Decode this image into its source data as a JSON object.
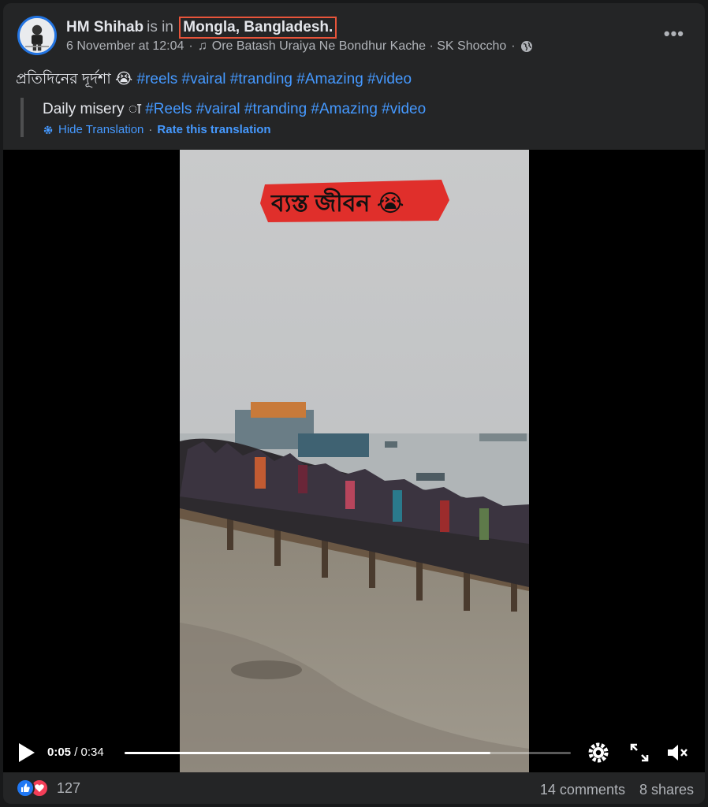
{
  "post": {
    "author": "HM Shihab",
    "is_in": "is in",
    "location": "Mongla, Bangladesh",
    "location_suffix": ".",
    "date": "6 November at 12:04",
    "separator": "·",
    "music": "Ore Batash Uraiya Ne Bondhur Kache · SK Shoccho",
    "audience_icon": "globe-icon",
    "caption_text": "প্রতিদিনের দূর্দশা 😭",
    "caption_tags": "#reels #vairal #tranding #Amazing #video"
  },
  "translation": {
    "text": "Daily misery ा",
    "tags": "#Reels #vairal #tranding #Amazing #video",
    "hide_label": "Hide Translation",
    "rate_label": "Rate this translation"
  },
  "video": {
    "overlay_text": "ব্যস্ত জীবন 😭",
    "current_time": "0:05",
    "time_separator": "/",
    "duration": "0:34",
    "progress_fraction": 0.82
  },
  "footer": {
    "reaction_count": "127",
    "comments": "14 comments",
    "shares": "8 shares"
  },
  "colors": {
    "accent": "#4599ff",
    "highlight_box": "#e8543a",
    "overlay_red": "#e02f2b"
  }
}
